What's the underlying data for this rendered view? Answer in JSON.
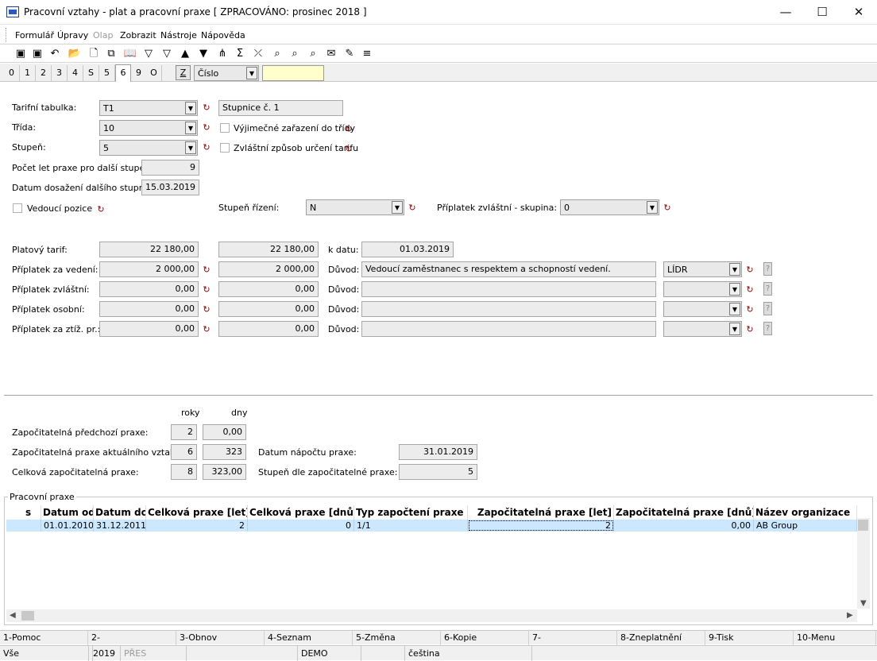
{
  "window": {
    "title": "Pracovní vztahy - plat a pracovní praxe  [ ZPRACOVÁNO: prosinec 2018 ]",
    "minimize": "—",
    "maximize": "☐",
    "close": "✕"
  },
  "menu": {
    "items": [
      "Formulář",
      "Úpravy",
      "Olap",
      "Zobrazit",
      "Nástroje",
      "Nápověda"
    ]
  },
  "toolbar": {
    "icons": [
      "save-icon",
      "save-as-icon",
      "undo-icon",
      "open-folder-icon",
      "new-page-icon",
      "copy-icon",
      "book-icon",
      "filter-icon",
      "filter-clear-icon",
      "arrow-up-icon",
      "arrow-down-icon",
      "tree-filter-icon",
      "sum-icon",
      "clear-filter-icon",
      "find-icon",
      "find-next-icon",
      "find-all-icon",
      "mail-icon",
      "notes-icon",
      "menu-icon"
    ],
    "glyphs": [
      "▣",
      "▣",
      "↶",
      "📂",
      "🗋",
      "⧉",
      "📖",
      "▽",
      "▽",
      "▲",
      "▼",
      "⋔",
      "Σ",
      "⤫",
      "⌕",
      "⌕",
      "⌕",
      "✉",
      "✎",
      "≡"
    ]
  },
  "tabs": {
    "items": [
      "0",
      "1",
      "2",
      "3",
      "4",
      "S",
      "5",
      "6",
      "9",
      "O"
    ],
    "active_index": 7,
    "z_button": "Z",
    "sort_select": "Číslo",
    "search_value": ""
  },
  "salary": {
    "tarif_table_label": "Tarifní tabulka:",
    "tarif_table_value": "T1",
    "tarif_table_desc": "Stupnice č. 1",
    "class_label": "Třída:",
    "class_value": "10",
    "exceptional_label": "Výjimečné zařazení do třídy",
    "grade_label": "Stupeň:",
    "grade_value": "5",
    "special_tariff_label": "Zvláštní způsob určení tarifu",
    "years_next_label": "Počet let praxe pro další stupeň:",
    "years_next_value": "9",
    "date_next_label": "Datum dosažení dalšího stupně:",
    "date_next_value": "15.03.2019",
    "lead_position_label": "Vedoucí pozice",
    "mgmt_level_label": "Stupeň řízení:",
    "mgmt_level_value": "N",
    "special_group_label": "Příplatek zvláštní - skupina:",
    "special_group_value": "0"
  },
  "pay": {
    "rows": [
      {
        "label": "Platový tarif:",
        "v1": "22 180,00",
        "v2": "22 180,00",
        "reason_label": "k datu:",
        "reason": "01.03.2019",
        "code": "",
        "is_date": true
      },
      {
        "label": "Příplatek za vedení:",
        "v1": "2 000,00",
        "v2": "2 000,00",
        "reason_label": "Důvod:",
        "reason": "Vedoucí zaměstnanec s respektem a schopností vedení.",
        "code": "LÍDR",
        "is_date": false
      },
      {
        "label": "Příplatek zvláštní:",
        "v1": "0,00",
        "v2": "0,00",
        "reason_label": "Důvod:",
        "reason": "",
        "code": "",
        "is_date": false
      },
      {
        "label": "Příplatek osobní:",
        "v1": "0,00",
        "v2": "0,00",
        "reason_label": "Důvod:",
        "reason": "",
        "code": "",
        "is_date": false
      },
      {
        "label": "Příplatek za ztíž. pr.:",
        "v1": "0,00",
        "v2": "0,00",
        "reason_label": "Důvod:",
        "reason": "",
        "code": "",
        "is_date": false
      }
    ],
    "question_mark": "?"
  },
  "practice": {
    "col_years": "roky",
    "col_days": "dny",
    "prev_label": "Započitatelná předchozí praxe:",
    "prev_years": "2",
    "prev_days": "0,00",
    "current_label": "Započitatelná praxe aktuálního vztahu:",
    "current_years": "6",
    "current_days": "323",
    "total_label": "Celková započitatelná praxe:",
    "total_years": "8",
    "total_days": "323,00",
    "count_date_label": "Datum nápočtu praxe:",
    "count_date_value": "31.01.2019",
    "grade_by_label": "Stupeň dle započitatelné praxe:",
    "grade_by_value": "5"
  },
  "grid": {
    "title": "Pracovní praxe",
    "columns": [
      "s",
      "Datum od",
      "Datum do",
      "Celková praxe [let]",
      "Celková praxe [dnů]",
      "Typ započtení praxe",
      "Započitatelná praxe [let]",
      "Započitatelná praxe [dnů]",
      "Název organizace"
    ],
    "rows": [
      [
        "",
        "01.01.2010",
        "31.12.2011",
        "2",
        "0",
        "1/1",
        "2",
        "0,00",
        "AB Group"
      ]
    ]
  },
  "fkeys": [
    "1-Pomoc",
    "2-",
    "3-Obnov",
    "4-Seznam",
    "5-Změna",
    "6-Kopie",
    "7-",
    "8-Zneplatnění",
    "9-Tisk",
    "10-Menu"
  ],
  "status": [
    "Vše",
    "",
    "2019",
    "PŘES",
    "",
    "DEMO",
    "",
    "čeština"
  ]
}
